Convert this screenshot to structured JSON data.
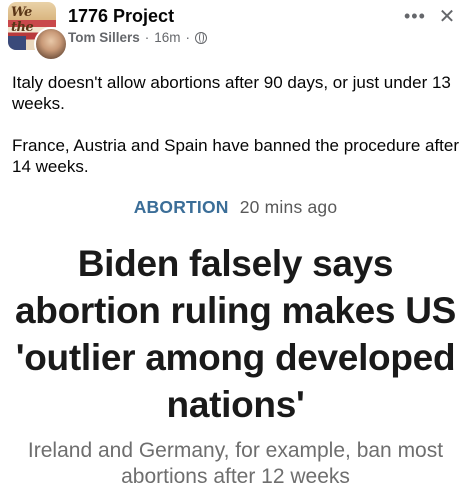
{
  "post": {
    "group_name": "1776 Project",
    "avatar_text": "We the",
    "author": "Tom Sillers",
    "separator": "·",
    "time": "16m",
    "separator2": "·",
    "more_label": "•••",
    "close_label": "✕",
    "paragraphs": [
      "Italy doesn't allow abortions after 90 days, or just under 13 weeks.",
      "France, Austria and Spain have banned the procedure after 14 weeks."
    ]
  },
  "article": {
    "category": "ABORTION",
    "time": "20 mins ago",
    "headline": "Biden falsely says abortion ruling makes US 'outlier among developed nations'",
    "subhead": "Ireland and Germany, for example, ban most abortions after 12 weeks"
  },
  "icons": {
    "globe": "globe-icon",
    "more": "more-options-icon",
    "close": "close-icon"
  },
  "colors": {
    "category": "#3b6e98",
    "meta": "#65676b"
  }
}
